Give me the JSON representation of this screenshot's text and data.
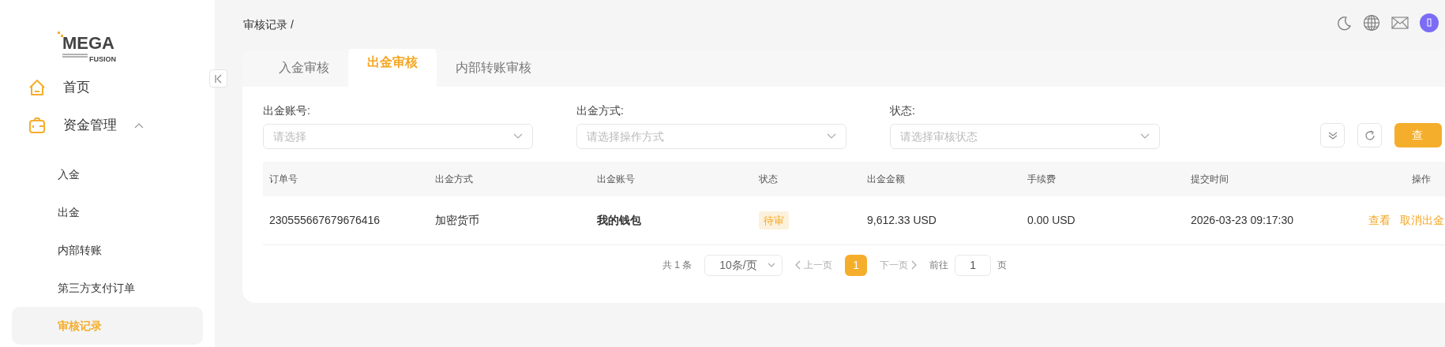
{
  "sidebar": {
    "logo": {
      "word": "MEGA",
      "sub": "FUSION"
    },
    "items": [
      {
        "label": "首页",
        "selected": false
      },
      {
        "label": "资金管理",
        "expanded": true,
        "selected": false,
        "children": [
          {
            "label": "入金",
            "selected": false
          },
          {
            "label": "出金",
            "selected": false
          },
          {
            "label": "内部转账",
            "selected": false
          },
          {
            "label": "第三方支付订单",
            "selected": false
          },
          {
            "label": "审核记录",
            "selected": true
          }
        ]
      }
    ]
  },
  "breadcrumb": [
    "审核记录 /"
  ],
  "tabs": [
    {
      "label": "入金审核",
      "selected": false
    },
    {
      "label": "出金审核",
      "selected": true
    },
    {
      "label": "内部转账审核",
      "selected": false
    }
  ],
  "filters": [
    {
      "label": "出金账号:",
      "placeholder": "请选择"
    },
    {
      "label": "出金方式:",
      "placeholder": "请选择操作方式"
    },
    {
      "label": "状态:",
      "placeholder": "请选择审核状态"
    }
  ],
  "query_button": "查",
  "table": {
    "columns": [
      "订单号",
      "出金方式",
      "出金账号",
      "状态",
      "出金金额",
      "手续费",
      "提交时间",
      "操作"
    ],
    "rows": [
      {
        "cells": [
          {
            "kind": "text",
            "text": "230555667679676416"
          },
          {
            "kind": "text",
            "text": "加密货币"
          },
          {
            "kind": "strong",
            "text": "我的钱包"
          },
          {
            "kind": "badge",
            "text": "待审"
          },
          {
            "kind": "text",
            "text": "9,612.33 USD"
          },
          {
            "kind": "text",
            "text": "0.00 USD"
          },
          {
            "kind": "text",
            "text": "2026-03-23 09:17:30"
          },
          {
            "kind": "actions",
            "links": [
              "查看",
              "取消出金"
            ]
          }
        ]
      }
    ]
  },
  "pagination": {
    "total": "共 1 条",
    "page_size": "10条/页",
    "prev": "上一页",
    "next": "下一页",
    "prev_disabled": true,
    "next_disabled": true,
    "pages": [
      {
        "label": "1",
        "selected": true
      }
    ],
    "goto_label": "前往",
    "goto_value": "1",
    "goto_suffix": "页"
  }
}
